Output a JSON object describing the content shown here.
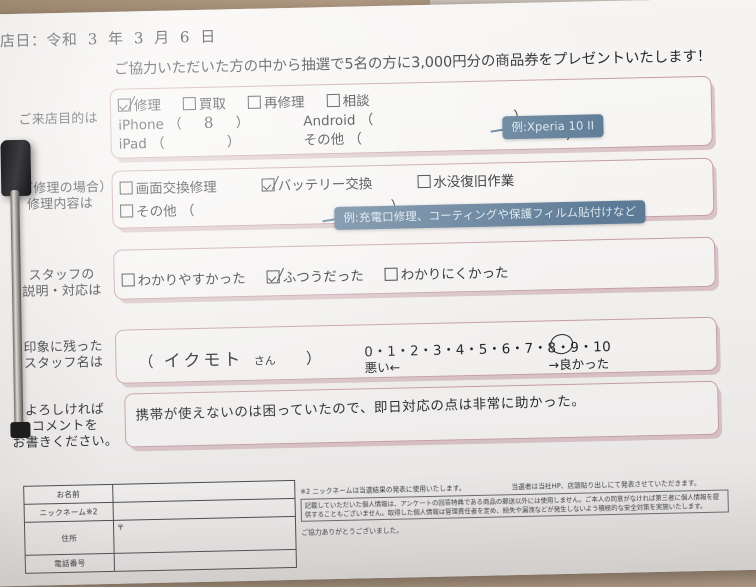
{
  "document": {
    "type": "customer-satisfaction-survey",
    "visit_date": {
      "label": "来店日：令和",
      "era_year": "3",
      "year_unit": "年",
      "month": "3",
      "month_unit": "月",
      "day": "6",
      "day_unit": "日"
    },
    "banner": "ご協力いただいた方の中から抽選で5名の方に3,000円分の商品券をプレゼントいたします！"
  },
  "sections": {
    "purpose": {
      "label_line1": "ご来店目的は",
      "options": [
        {
          "label": "修理",
          "checked": true
        },
        {
          "label": "買取",
          "checked": false
        },
        {
          "label": "再修理",
          "checked": false
        },
        {
          "label": "相談",
          "checked": false
        }
      ],
      "fields": [
        {
          "label": "iPhone",
          "open": "（",
          "value": "8",
          "close": "）"
        },
        {
          "label": "iPad",
          "open": "（",
          "value": "",
          "close": "）"
        },
        {
          "label": "Android",
          "open": "（",
          "value": "",
          "close": "）"
        },
        {
          "label": "その他",
          "open": "（",
          "value": "",
          "close": "）"
        }
      ],
      "tooltip": "例:Xperia 10 II"
    },
    "repair_content": {
      "label_line1": "（ご修理の場合）",
      "label_line2": "修理内容は",
      "options": [
        {
          "label": "画面交換修理",
          "checked": false
        },
        {
          "label": "バッテリー交換",
          "checked": true
        },
        {
          "label": "水没復旧作業",
          "checked": false
        },
        {
          "label": "その他",
          "checked": false
        }
      ],
      "other_open": "（",
      "other_close": "）",
      "tooltip": "例:充電口修理、コーティングや保護フィルム貼付けなど"
    },
    "staff_explanation": {
      "label_line1": "スタッフの",
      "label_line2": "説明・対応は",
      "options": [
        {
          "label": "わかりやすかった",
          "checked": false
        },
        {
          "label": "ふつうだった",
          "checked": true
        },
        {
          "label": "わかりにくかった",
          "checked": false
        }
      ]
    },
    "staff_name": {
      "label_line1": "印象に残った",
      "label_line2": "スタッフ名は",
      "open": "（",
      "value": "イクモト",
      "suffix": "さん",
      "close": "）"
    },
    "rating": {
      "scale": "0・1・2・3・4・5・6・7・8・9・10",
      "low_label": "悪い←",
      "high_label": "→良かった",
      "selected": 8,
      "min": 0,
      "max": 10
    },
    "comment": {
      "label_line1": "よろしければ",
      "label_line2": "コメントを",
      "label_line3": "お書きください。",
      "value": "携帯が使えないのは困っていたので、即日対応の点は非常に助かった。"
    }
  },
  "contact_table": {
    "rows": [
      {
        "label": "お名前",
        "value": ""
      },
      {
        "label": "ニックネーム※2",
        "value": ""
      },
      {
        "label": "住所",
        "value": "",
        "postal_mark": "〒"
      },
      {
        "label": "電話番号",
        "value": ""
      }
    ]
  },
  "fine_print": {
    "note_left": "※2 ニックネームは当選結果の発表に使用いたします。",
    "note_right": "当選者は当社HP、店頭貼り出しにて発表させていただきます。",
    "privacy": "記載していただいた個人情報は、アンケートの回答特典である商品の郵送以外には使用しません。ご本人の同意がなければ第三者に個人情報を提供することもございません。取得した個人情報は管理責任者を定め、紛失や漏洩などが発生しないよう積極的な安全対策を実施いたします。",
    "thanks": "ご協力ありがとうございました。"
  },
  "colors": {
    "form_border": "#c39ca4",
    "tooltip_bg": "#5d7b96",
    "tooltip_text": "#dbe5ee",
    "paper": "#f5f3f1",
    "desk": "#a08a72",
    "ink": "#25262a"
  }
}
